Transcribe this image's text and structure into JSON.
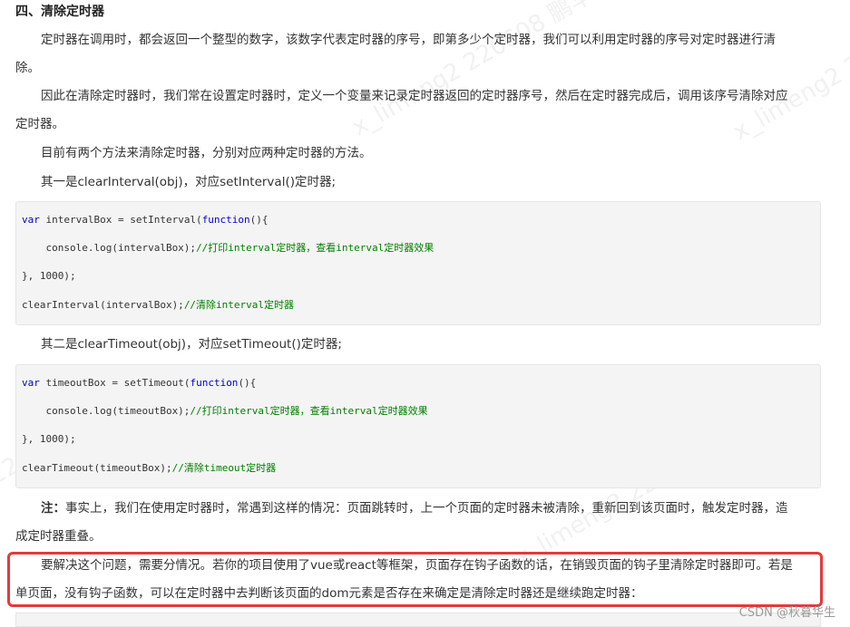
{
  "article": {
    "heading": "四、清除定时器",
    "paragraphs": {
      "p1": "定时器在调用时，都会返回一个整型的数字，该数字代表定时器的序号，即第多少个定时器，我们可以利用定时器的序号对定时器进行清",
      "p1_cont": "除。",
      "p2": "因此在清除定时器时，我们常在设置定时器时，定义一个变量来记录定时器返回的定时器序号，然后在定时器完成后，调用该序号清除对应",
      "p2_cont": "定时器。",
      "p3": "目前有两个方法来清除定时器，分别对应两种定时器的方法。",
      "p4": "其一是clearInterval(obj)，对应setInterval()定时器;",
      "p5": "其二是clearTimeout(obj)，对应setTimeout()定时器;",
      "note_label": "注：",
      "note_text": "事实上，我们在使用定时器时，常遇到这样的情况：页面跳转时，上一个页面的定时器未被清除，重新回到该页面时，触发定时器，造",
      "note_cont": "成定时器重叠。",
      "solution": "要解决这个问题，需要分情况。若你的项目使用了vue或react等框架，页面存在钩子函数的话，在销毁页面的钩子里清除定时器即可。若是",
      "solution_cont": "单页面，没有钩子函数，可以在定时器中去判断该页面的dom元素是否存在来确定是清除定时器还是继续跑定时器："
    },
    "code1": {
      "line1_kw": "var",
      "line1_rest": " intervalBox = setInterval(",
      "line1_kw2": "function",
      "line1_end": "(){",
      "line2_code": "    console.log(intervalBox);",
      "line2_comment": "//打印interval定时器，查看interval定时器效果",
      "line3": "}, 1000);",
      "line4_code": "clearInterval(intervalBox);",
      "line4_comment": "//清除interval定时器"
    },
    "code2": {
      "line1_kw": "var",
      "line1_rest": " timeoutBox = setTimeout(",
      "line1_kw2": "function",
      "line1_end": "(){",
      "line2_code": "    console.log(timeoutBox);",
      "line2_comment": "//打印interval定时器，查看interval定时器效果",
      "line3": "}, 1000);",
      "line4_code": "clearTimeout(timeoutBox);",
      "line4_comment": "//清除timeout定时器"
    }
  },
  "watermark": {
    "text1": "x_limeng2 220608 鹏华",
    "text2": "x_limeng2 220608 鹏华",
    "text3": "220608 鹏华",
    "text4": "x_limeng2 220608 鹏华"
  },
  "footer": {
    "csdn_credit": "CSDN @秋暮华生"
  },
  "colors": {
    "highlight_border": "#e4393c",
    "keyword": "#0000cc",
    "comment": "#008000",
    "code_bg": "#f4f4f4"
  }
}
